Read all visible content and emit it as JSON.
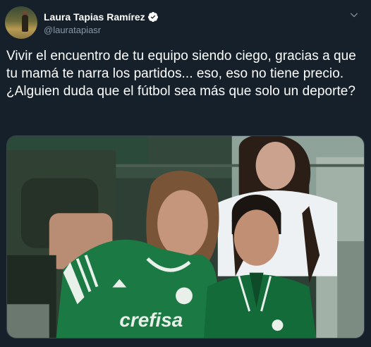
{
  "author": {
    "display_name": "Laura Tapias Ramírez",
    "handle": "@lauratapiasr",
    "avatar_icon": "profile-photo",
    "verified_icon": "verified-badge-icon"
  },
  "tweet": {
    "text": "Vivir el encuentro de tu equipo siendo ciego, gracias a que tu mamá te narra los partidos... eso, eso no tiene precio. ¿Alguien duda que el fútbol sea más que solo un deporte?"
  },
  "media": {
    "shirt_sponsor": "crefisa"
  },
  "colors": {
    "background": "#15202b",
    "secondary_text": "#8899a6",
    "border": "#38444d",
    "jersey_green": "#1e7a45"
  }
}
